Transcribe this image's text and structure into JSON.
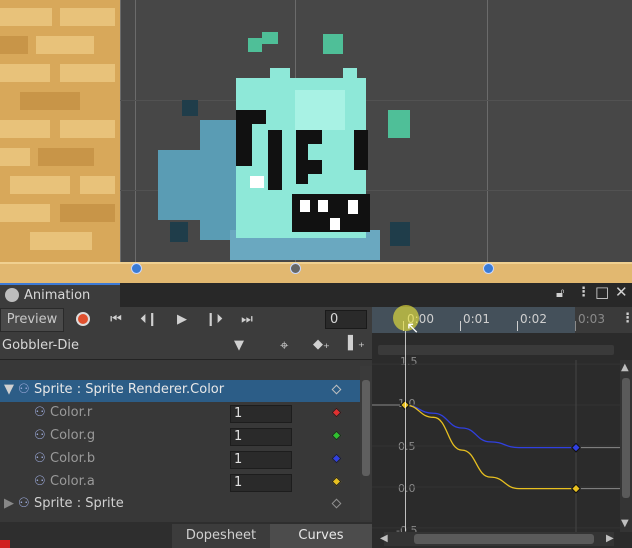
{
  "window": {
    "tab_title": "Animation",
    "lock_icon": "lock-icon",
    "menu_icon": "kebab-menu-icon",
    "maximize_icon": "maximize-icon",
    "close_icon": "close-icon"
  },
  "toolbar": {
    "preview_label": "Preview",
    "frame_value": "0"
  },
  "clip": {
    "name": "Gobbler-Die"
  },
  "properties": [
    {
      "label": "Sprite : Sprite Renderer.Color",
      "value": "",
      "key_color": "#c0c0c0",
      "selected": true,
      "level": 0
    },
    {
      "label": "Color.r",
      "value": "1",
      "key_color": "#e03030",
      "selected": false,
      "level": 1
    },
    {
      "label": "Color.g",
      "value": "1",
      "key_color": "#30c030",
      "selected": false,
      "level": 1
    },
    {
      "label": "Color.b",
      "value": "1",
      "key_color": "#3040e0",
      "selected": false,
      "level": 1
    },
    {
      "label": "Color.a",
      "value": "1",
      "key_color": "#e8c020",
      "selected": false,
      "level": 1
    },
    {
      "label": "Sprite : Sprite",
      "value": "",
      "key_color": "#909090",
      "selected": false,
      "level": 0
    }
  ],
  "bottom_tabs": {
    "dopesheet": "Dopesheet",
    "curves": "Curves"
  },
  "timeline": {
    "ticks": [
      "0:00",
      "0:01",
      "0:02",
      "0:03"
    ]
  },
  "curves": {
    "y_labels": [
      "1.5",
      "1.0",
      "0.5",
      "0.0",
      "-0.5"
    ]
  },
  "chart_data": {
    "type": "line",
    "x": [
      0.0,
      0.5,
      1.0,
      1.5,
      2.0,
      2.5,
      3.0
    ],
    "xlabel": "",
    "ylabel": "",
    "xlim": [
      -0.1,
      3.1
    ],
    "ylim": [
      -0.55,
      1.55
    ],
    "series": [
      {
        "color": "#3040e0",
        "values": [
          1.0,
          0.9,
          0.72,
          0.55,
          0.48,
          0.48,
          0.48
        ]
      },
      {
        "color": "#e8c020",
        "values": [
          1.0,
          0.85,
          0.45,
          0.12,
          -0.02,
          -0.02,
          -0.02
        ]
      }
    ]
  },
  "colors": {
    "accent": "#3d7ad6",
    "selection": "#2c5d87",
    "record": "#e0502e"
  }
}
